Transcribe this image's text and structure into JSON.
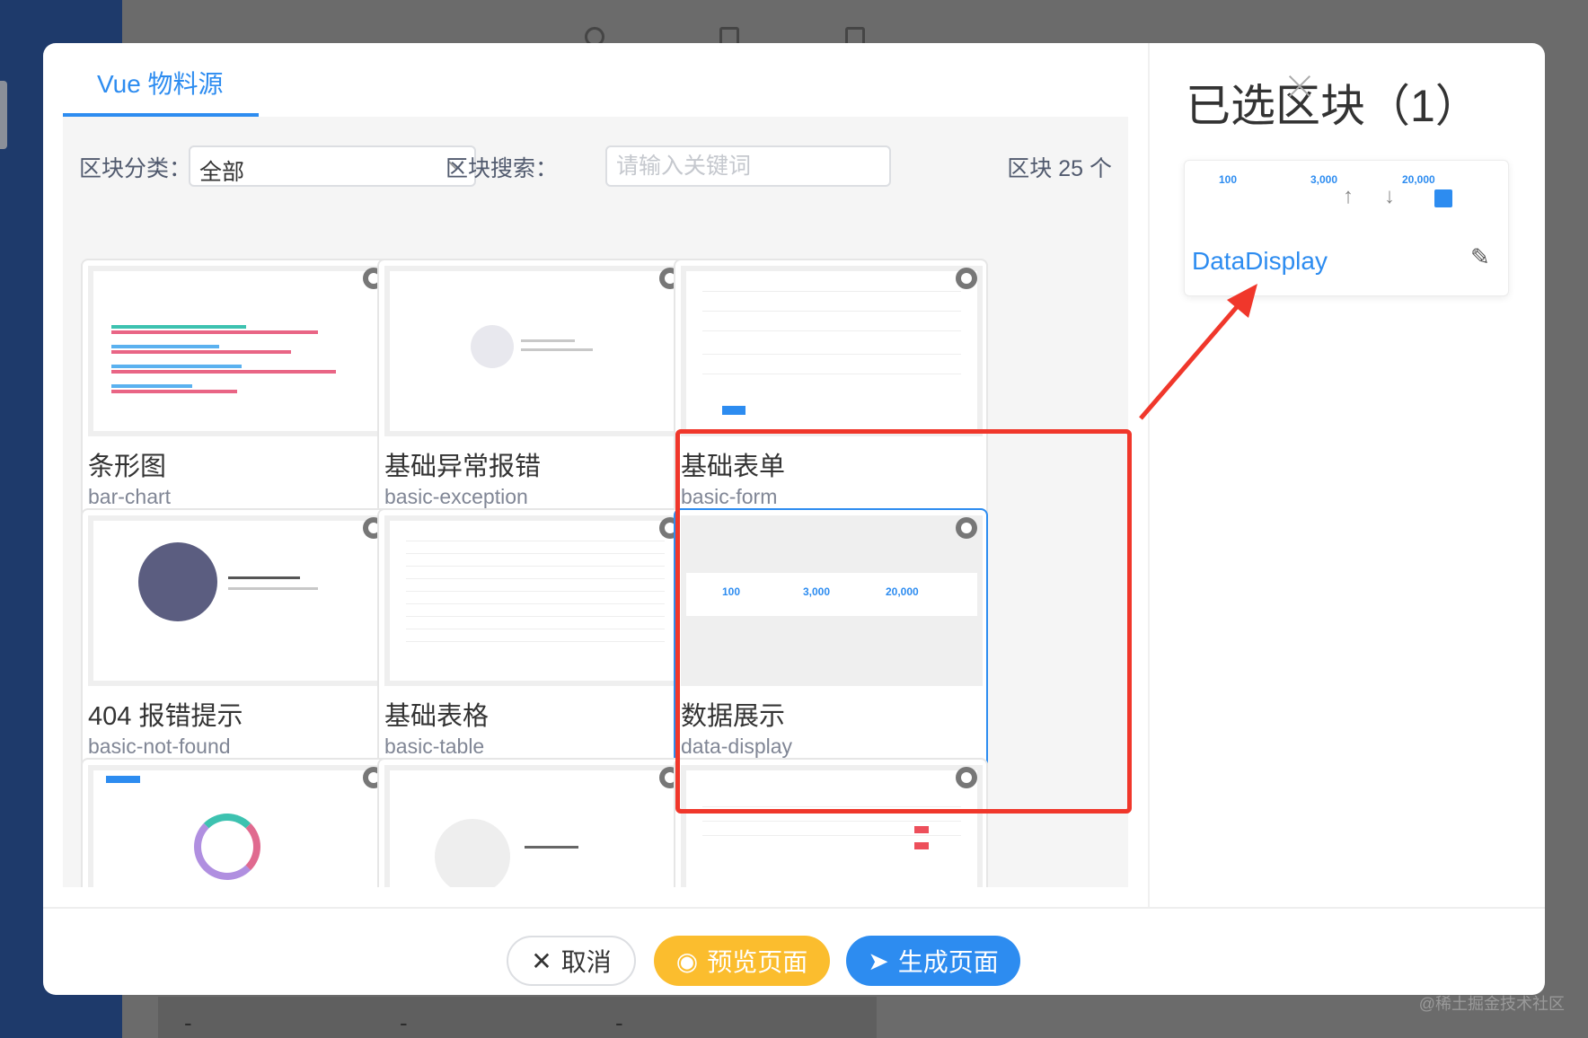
{
  "tabs": [
    {
      "label": "Vue 物料源"
    }
  ],
  "filter": {
    "category_label": "区块分类：",
    "category_value": "全部",
    "search_label": "区块搜索：",
    "search_placeholder": "请输入关键词",
    "count_text": "区块 25 个"
  },
  "blocks": [
    {
      "title": "条形图",
      "name": "bar-chart"
    },
    {
      "title": "基础异常报错",
      "name": "basic-exception"
    },
    {
      "title": "基础表单",
      "name": "basic-form"
    },
    {
      "title": "404 报错提示",
      "name": "basic-not-found"
    },
    {
      "title": "基础表格",
      "name": "basic-table"
    },
    {
      "title": "数据展示",
      "name": "data-display",
      "stats": [
        "100",
        "3,000",
        "20,000"
      ]
    }
  ],
  "selected": {
    "title": "已选区块（1）",
    "items": [
      {
        "name": "DataDisplay",
        "stats": [
          "100",
          "3,000",
          "20,000"
        ]
      }
    ]
  },
  "footer": {
    "cancel": "取消",
    "preview": "预览页面",
    "generate": "生成页面"
  },
  "watermark": "@稀土掘金技术社区",
  "colors": {
    "primary": "#2d8cf0",
    "warning": "#fbbd2e",
    "annotation": "#f0372b"
  }
}
